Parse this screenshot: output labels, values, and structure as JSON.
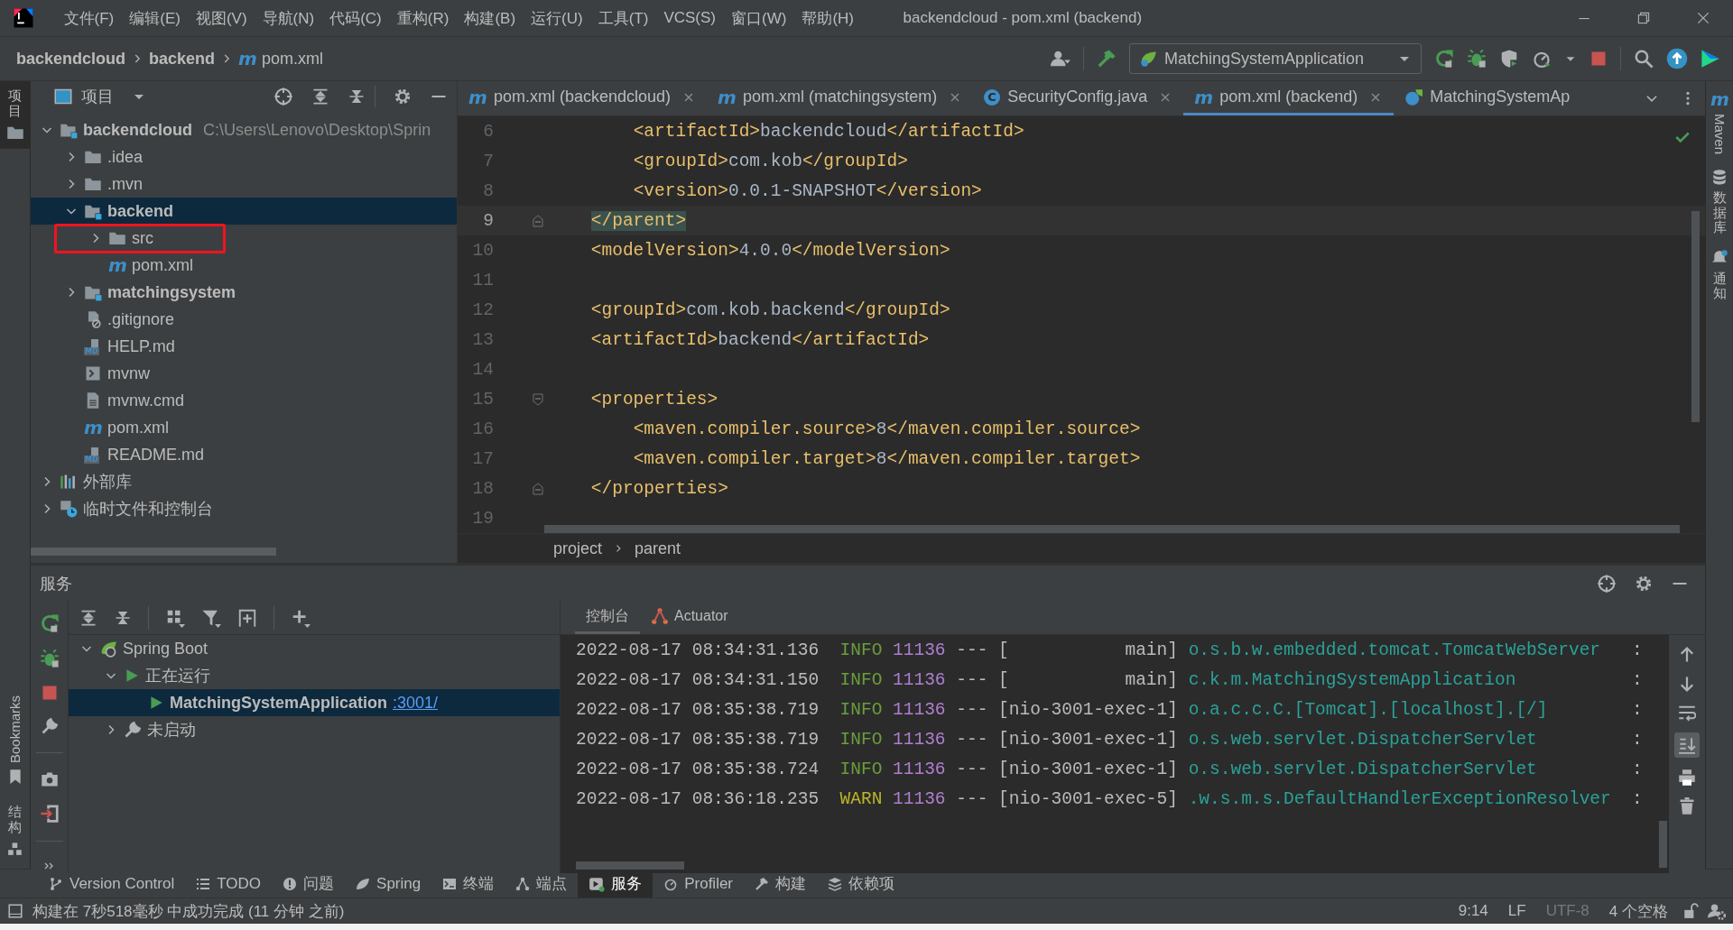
{
  "title_bar": {
    "menu": [
      "文件(F)",
      "编辑(E)",
      "视图(V)",
      "导航(N)",
      "代码(C)",
      "重构(R)",
      "构建(B)",
      "运行(U)",
      "工具(T)",
      "VCS(S)",
      "窗口(W)",
      "帮助(H)"
    ],
    "title": "backendcloud - pom.xml (backend)"
  },
  "nav_bar": {
    "breadcrumbs": [
      {
        "label": "backendcloud",
        "kind": "module"
      },
      {
        "label": "backend",
        "kind": "module"
      },
      {
        "label": "pom.xml",
        "kind": "maven",
        "icon": "m"
      }
    ],
    "run_config": "MatchingSystemApplication"
  },
  "left_strip": {
    "top": "项目",
    "bottom": [
      {
        "label": "Bookmarks",
        "kind": "bookmark"
      },
      {
        "label": "结构",
        "kind": "structure"
      }
    ]
  },
  "project_panel": {
    "title": "项目",
    "tree": [
      {
        "label": "backendcloud",
        "kind": "module",
        "path": "C:\\Users\\Lenovo\\Desktop\\Sprin",
        "expanded": true,
        "selected": false,
        "annotated": false,
        "children": [
          {
            "label": ".idea",
            "kind": "folder",
            "expanded": false,
            "selected": false,
            "annotated": false
          },
          {
            "label": ".mvn",
            "kind": "folder",
            "expanded": false,
            "selected": false,
            "annotated": false
          },
          {
            "label": "backend",
            "kind": "module",
            "expanded": true,
            "selected": true,
            "annotated": false,
            "children": [
              {
                "label": "src",
                "kind": "folder",
                "expanded": false,
                "selected": false,
                "annotated": true
              },
              {
                "label": "pom.xml",
                "kind": "maven",
                "icon": "m",
                "selected": false,
                "annotated": false
              }
            ]
          },
          {
            "label": "matchingsystem",
            "kind": "module",
            "expanded": false,
            "selected": false,
            "annotated": false
          },
          {
            "label": ".gitignore",
            "kind": "ignore-file",
            "selected": false,
            "annotated": false
          },
          {
            "label": "HELP.md",
            "kind": "markdown",
            "icon": "MD",
            "selected": false,
            "annotated": false
          },
          {
            "label": "mvnw",
            "kind": "script",
            "selected": false,
            "annotated": false
          },
          {
            "label": "mvnw.cmd",
            "kind": "text-file",
            "selected": false,
            "annotated": false
          },
          {
            "label": "pom.xml",
            "kind": "maven",
            "icon": "m",
            "selected": false,
            "annotated": false
          },
          {
            "label": "README.md",
            "kind": "markdown",
            "icon": "MD",
            "selected": false,
            "annotated": false
          }
        ]
      },
      {
        "label": "外部库",
        "kind": "library",
        "expanded": false,
        "selected": false,
        "annotated": false
      },
      {
        "label": "临时文件和控制台",
        "kind": "scratch",
        "expanded": false,
        "selected": false,
        "annotated": false
      }
    ]
  },
  "editor": {
    "tabs": [
      {
        "label": "pom.xml (backendcloud)",
        "kind": "maven",
        "icon": "m",
        "selected": false
      },
      {
        "label": "pom.xml (matchingsystem)",
        "kind": "maven",
        "icon": "m",
        "selected": false
      },
      {
        "label": "SecurityConfig.java",
        "kind": "class",
        "icon": "C",
        "selected": false
      },
      {
        "label": "pom.xml (backend)",
        "kind": "maven",
        "icon": "m",
        "selected": true
      },
      {
        "label": "MatchingSystemAp",
        "kind": "spring-class",
        "selected": false
      }
    ],
    "lines": [
      {
        "number": "6",
        "kind": "plain",
        "text": "        <artifactId>backendcloud</artifactId>",
        "current": false
      },
      {
        "number": "7",
        "kind": "plain",
        "text": "        <groupId>com.kob</groupId>",
        "current": false
      },
      {
        "number": "8",
        "kind": "plain",
        "text": "        <version>0.0.1-SNAPSHOT</version>",
        "current": false
      },
      {
        "number": "9",
        "kind": "fold-end",
        "text": "    </parent>",
        "current": true
      },
      {
        "number": "10",
        "kind": "plain",
        "text": "    <modelVersion>4.0.0</modelVersion>",
        "current": false
      },
      {
        "number": "11",
        "kind": "plain",
        "current": false
      },
      {
        "number": "12",
        "kind": "plain",
        "text": "    <groupId>com.kob.backend</groupId>",
        "current": false
      },
      {
        "number": "13",
        "kind": "plain",
        "text": "    <artifactId>backend</artifactId>",
        "current": false
      },
      {
        "number": "14",
        "kind": "plain",
        "current": false
      },
      {
        "number": "15",
        "kind": "fold-start",
        "text": "    <properties>",
        "current": false
      },
      {
        "number": "16",
        "kind": "plain",
        "text": "        <maven.compiler.source>8</maven.compiler.source>",
        "current": false
      },
      {
        "number": "17",
        "kind": "plain",
        "text": "        <maven.compiler.target>8</maven.compiler.target>",
        "current": false
      },
      {
        "number": "18",
        "kind": "fold-end",
        "text": "    </properties>",
        "current": false
      },
      {
        "number": "19",
        "kind": "plain",
        "current": false
      }
    ],
    "breadcrumbs": [
      "project",
      "parent"
    ]
  },
  "right_strip": [
    {
      "label": "Maven",
      "kind": "maven",
      "icon": "m"
    },
    {
      "label": "数据库",
      "kind": "database"
    },
    {
      "label": "通知",
      "kind": "notifications"
    }
  ],
  "services": {
    "title": "服务",
    "tree": [
      {
        "label": "Spring Boot",
        "kind": "spring",
        "expanded": true,
        "selected": false,
        "children": [
          {
            "label": "正在运行",
            "kind": "running",
            "expanded": true,
            "selected": false,
            "children": [
              {
                "label": "MatchingSystemApplication",
                "link": ":3001/",
                "kind": "app",
                "selected": true
              }
            ]
          },
          {
            "label": "未启动",
            "kind": "not-started",
            "expanded": false,
            "selected": false
          }
        ]
      }
    ],
    "console_tabs": [
      {
        "label": "控制台",
        "kind": "console",
        "selected": true
      },
      {
        "label": "Actuator",
        "kind": "actuator",
        "selected": false
      }
    ],
    "log": [
      {
        "time": "2022-08-17 08:34:31.136",
        "level": "INFO",
        "kind": "info",
        "pid": "11136",
        "sep": "---",
        "thread": "[           main]",
        "logger": "o.s.b.w.embedded.tomcat.TomcatWebServer",
        "colon": ":"
      },
      {
        "time": "2022-08-17 08:34:31.150",
        "level": "INFO",
        "kind": "info",
        "pid": "11136",
        "sep": "---",
        "thread": "[           main]",
        "logger": "c.k.m.MatchingSystemApplication",
        "colon": ":"
      },
      {
        "time": "2022-08-17 08:35:38.719",
        "level": "INFO",
        "kind": "info",
        "pid": "11136",
        "sep": "---",
        "thread": "[nio-3001-exec-1]",
        "logger": "o.a.c.c.C.[Tomcat].[localhost].[/]",
        "colon": ":"
      },
      {
        "time": "2022-08-17 08:35:38.719",
        "level": "INFO",
        "kind": "info",
        "pid": "11136",
        "sep": "---",
        "thread": "[nio-3001-exec-1]",
        "logger": "o.s.web.servlet.DispatcherServlet",
        "colon": ":"
      },
      {
        "time": "2022-08-17 08:35:38.724",
        "level": "INFO",
        "kind": "info",
        "pid": "11136",
        "sep": "---",
        "thread": "[nio-3001-exec-1]",
        "logger": "o.s.web.servlet.DispatcherServlet",
        "colon": ":"
      },
      {
        "time": "2022-08-17 08:36:18.235",
        "level": "WARN",
        "kind": "warn",
        "pid": "11136",
        "sep": "---",
        "thread": "[nio-3001-exec-5]",
        "logger": ".w.s.m.s.DefaultHandlerExceptionResolver",
        "colon": ":"
      }
    ]
  },
  "tool_windows": [
    {
      "label": "Version Control",
      "kind": "vcs",
      "selected": false
    },
    {
      "label": "TODO",
      "kind": "todo",
      "selected": false
    },
    {
      "label": "问题",
      "kind": "problems",
      "selected": false
    },
    {
      "label": "Spring",
      "kind": "spring",
      "selected": false
    },
    {
      "label": "终端",
      "kind": "terminal",
      "selected": false
    },
    {
      "label": "端点",
      "kind": "endpoints",
      "selected": false
    },
    {
      "label": "服务",
      "kind": "services",
      "selected": true
    },
    {
      "label": "Profiler",
      "kind": "profiler",
      "selected": false
    },
    {
      "label": "构建",
      "kind": "build",
      "selected": false
    },
    {
      "label": "依赖项",
      "kind": "dependencies",
      "selected": false
    }
  ],
  "status_bar": {
    "message": "构建在 7秒518毫秒 中成功完成 (11 分钟 之前)",
    "items": [
      {
        "label": "9:14",
        "disabled": false
      },
      {
        "label": "LF",
        "disabled": false
      },
      {
        "label": "UTF-8",
        "disabled": true
      },
      {
        "label": "4 个空格",
        "disabled": false
      }
    ]
  }
}
